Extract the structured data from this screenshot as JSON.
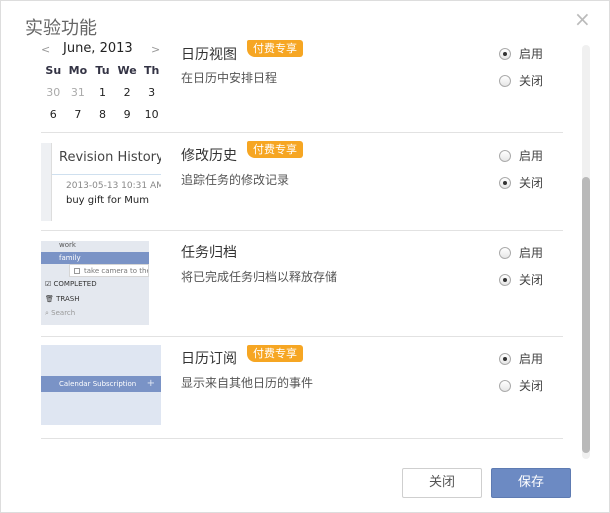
{
  "dialog": {
    "title": "实验功能",
    "close_glyph": "×",
    "options": {
      "on": "启用",
      "off": "关闭"
    },
    "paid_badge": "付费专享",
    "buttons": {
      "close": "关闭",
      "save": "保存"
    }
  },
  "features": [
    {
      "title": "日历视图",
      "paid": true,
      "desc": "在日历中安排日程",
      "enabled": true,
      "preview": {
        "type": "calendar",
        "prev": "<",
        "next": ">",
        "month": "June, 2013",
        "weekdays": [
          "Su",
          "Mo",
          "Tu",
          "We",
          "Th"
        ],
        "weeks": [
          [
            "30",
            "31",
            "1",
            "2",
            "3"
          ],
          [
            "6",
            "7",
            "8",
            "9",
            "10"
          ]
        ],
        "prev_month_days": 2
      }
    },
    {
      "title": "修改历史",
      "paid": true,
      "desc": "追踪任务的修改记录",
      "enabled": false,
      "preview": {
        "type": "revision",
        "heading": "Revision History",
        "date": "2013-05-13 10:31 AM",
        "text": "buy gift for Mum"
      }
    },
    {
      "title": "任务归档",
      "paid": false,
      "desc": "将已完成任务归档以释放存储",
      "enabled": false,
      "preview": {
        "type": "archive",
        "work": "work",
        "family": "family",
        "drag_text": "take camera to the c",
        "completed": "COMPLETED",
        "trash": "TRASH",
        "search": "Search"
      }
    },
    {
      "title": "日历订阅",
      "paid": true,
      "desc": "显示来自其他日历的事件",
      "enabled": true,
      "preview": {
        "type": "subscription",
        "label": "Calendar Subscription",
        "plus": "+"
      }
    }
  ]
}
